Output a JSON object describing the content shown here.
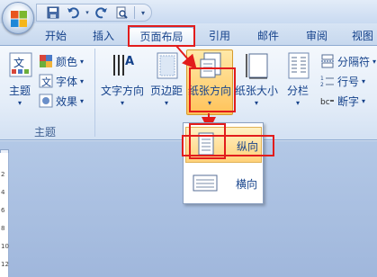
{
  "tabs": [
    {
      "label": "开始"
    },
    {
      "label": "插入"
    },
    {
      "label": "页面布局",
      "active": true
    },
    {
      "label": "引用"
    },
    {
      "label": "邮件"
    },
    {
      "label": "审阅"
    },
    {
      "label": "视图"
    }
  ],
  "ribbon": {
    "theme_group": {
      "themes_label": "主题",
      "colors_label": "颜色",
      "fonts_label": "字体",
      "effects_label": "效果",
      "group_label": "主题"
    },
    "page_setup": {
      "text_direction_label": "文字方向",
      "margins_label": "页边距",
      "orientation_label": "纸张方向",
      "size_label": "纸张大小",
      "columns_label": "分栏",
      "breaks_label": "分隔符",
      "line_numbers_label": "行号",
      "hyphenation_label": "断字"
    }
  },
  "orientation_menu": {
    "portrait_label": "纵向",
    "landscape_label": "横向"
  },
  "ruler": {
    "ticks": [
      "2",
      "4",
      "6",
      "8",
      "10",
      "12"
    ]
  },
  "colors": {
    "highlight_red": "#e21c1c",
    "ribbon_text": "#15428b",
    "hover_orange": "#ffc35a"
  }
}
